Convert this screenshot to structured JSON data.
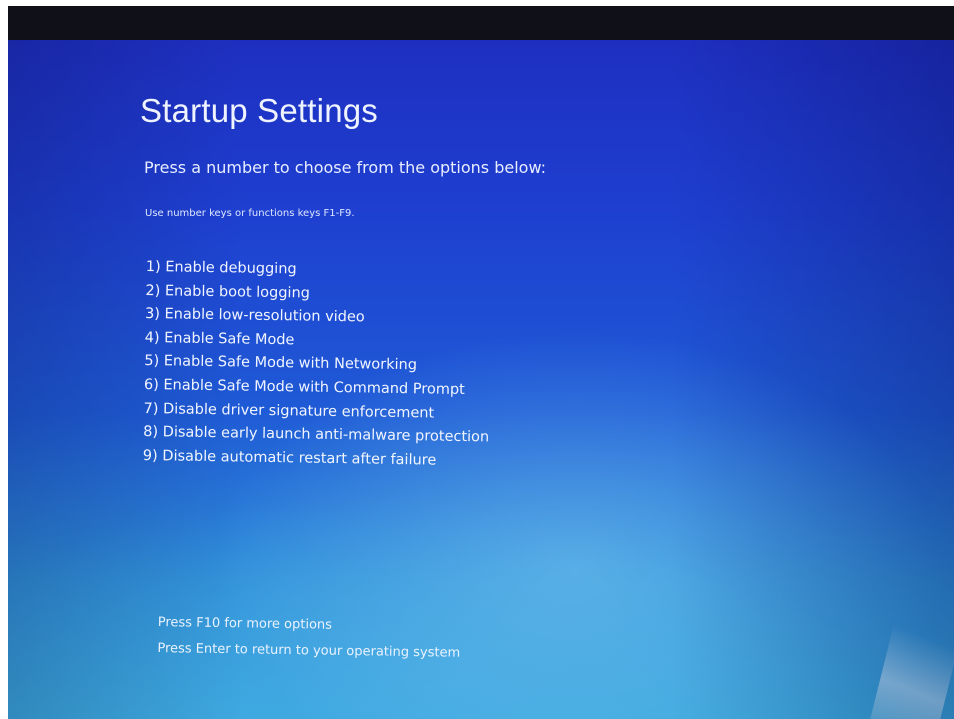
{
  "screen": {
    "title": "Startup Settings",
    "subtitle": "Press a number to choose from the options below:",
    "hint": "Use number keys or functions keys F1-F9.",
    "options": [
      {
        "label": "1) Enable debugging"
      },
      {
        "label": "2) Enable boot logging"
      },
      {
        "label": "3) Enable low-resolution video"
      },
      {
        "label": "4) Enable Safe Mode"
      },
      {
        "label": "5) Enable Safe Mode with Networking"
      },
      {
        "label": "6) Enable Safe Mode with Command Prompt"
      },
      {
        "label": "7) Disable driver signature enforcement"
      },
      {
        "label": "8) Disable early launch anti-malware protection"
      },
      {
        "label": "9) Disable automatic restart after failure"
      }
    ],
    "footer": {
      "more_options": "Press F10 for more options",
      "return_to_os": "Press Enter to return to your operating system"
    }
  },
  "colors": {
    "background_top": "#1e2fc0",
    "background_bottom": "#3aa8dc",
    "text": "#f1f5ff",
    "bezel": "#101018"
  }
}
